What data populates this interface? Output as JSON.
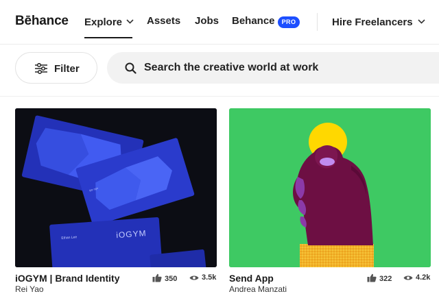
{
  "header": {
    "logo": "Bēhance",
    "nav": {
      "explore": "Explore",
      "assets": "Assets",
      "jobs": "Jobs",
      "behance": "Behance",
      "pro_badge": "PRO",
      "hire": "Hire Freelancers"
    }
  },
  "toolbar": {
    "filter_label": "Filter",
    "search_placeholder": "Search the creative world at work"
  },
  "projects": [
    {
      "title": "iOGYM | Brand Identity",
      "owner": "Rei Yao",
      "likes": "350",
      "views": "3.5k",
      "thumbnail_text": [
        "iOGYM",
        "Ethan Lee"
      ]
    },
    {
      "title": "Send App",
      "owner": "Andrea Manzati",
      "likes": "322",
      "views": "4.2k"
    }
  ],
  "colors": {
    "brand_blue": "#1d4fff",
    "card1_bg": "#0c0d14",
    "card1_cards": "#2331b8",
    "card2_bg": "#3ec963",
    "card2_hand": "#6d0f43",
    "card2_sun": "#ffd800"
  }
}
